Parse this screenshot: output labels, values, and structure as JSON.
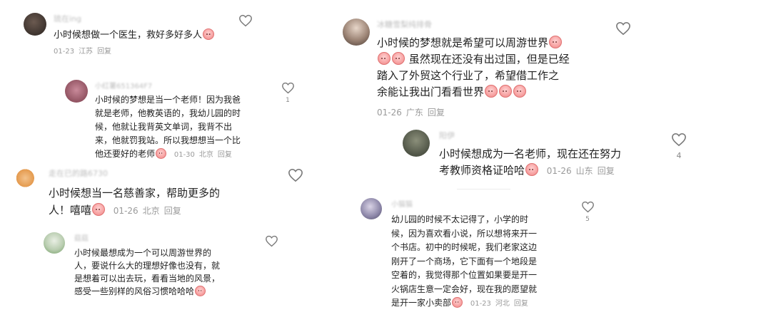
{
  "left": {
    "c1": {
      "user": "琉在ing",
      "text": "小时候想做一个医生，救好多好多人",
      "date": "01-23",
      "loc": "江苏",
      "reply": "回复"
    },
    "c2": {
      "user": "小红薯651364F7",
      "lines": [
        "小时候的梦想是当一个老师！因为我爸",
        "就是老师，他教英语的，我幼儿园的时",
        "候，他就让我背英文单词，我背不出",
        "来，他就罚我站。所以我想想当一个比",
        "他还要好的老师"
      ],
      "date": "01-30",
      "loc": "北京",
      "reply": "回复",
      "likes": "1"
    },
    "c3": {
      "user": "走在已的路6730",
      "lines": [
        "小时候想当一名慈善家，帮助更多的",
        "人！嘻嘻"
      ],
      "date": "01-26",
      "loc": "北京",
      "reply": "回复"
    },
    "c4": {
      "user": "菇菇",
      "lines": [
        "小时候最想成为一个可以周游世界的",
        "人，要说什么大的理想好像也没有，就",
        "是想着可以出去玩，看看当地的风景，",
        "感受一些别样的风俗习惯哈哈哈"
      ]
    }
  },
  "right": {
    "c1": {
      "user": "冰糖雪梨纯排骨",
      "lines": [
        "小时候的梦想就是希望可以周游世界",
        "虽然现在还没有出过国，但是已经",
        "踏入了外贸这个行业了，希望借工作之",
        "余能让我出门看看世界"
      ],
      "date": "01-26",
      "loc": "广东",
      "reply": "回复"
    },
    "c2": {
      "user": "阳伊",
      "lines": [
        "小时候想成为一名老师，现在还在努力",
        "考教师资格证哈哈"
      ],
      "date": "01-26",
      "loc": "山东",
      "reply": "回复",
      "likes": "4"
    },
    "c3": {
      "user": "小猫猫",
      "lines": [
        "幼儿园的时候不太记得了，小学的时",
        "候，因为喜欢看小说，所以想将来开一",
        "个书店。初中的时候呢，我们老家这边",
        "刚开了一个商场，它下面有一个地段是",
        "空着的，我觉得那个位置如果要是开一",
        "火锅店生意一定会好，现在我的愿望就",
        "是开一家小卖部"
      ],
      "date": "01-23",
      "loc": "河北",
      "reply": "回复",
      "likes": "5"
    }
  },
  "icons": {
    "like": "heart-outline-icon",
    "emoji": "blush-face-emoji"
  },
  "colors": {
    "text": "#222222",
    "meta": "#9a9a9a",
    "username": "#bdbdbd",
    "heart": "#7a7a7a"
  }
}
